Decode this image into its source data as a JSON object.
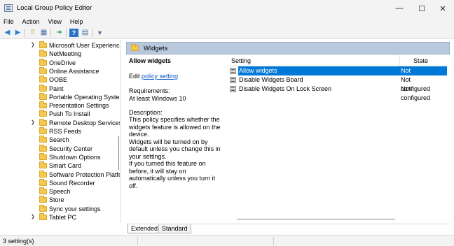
{
  "window": {
    "title": "Local Group Policy Editor",
    "minimize_glyph": "—",
    "maximize_glyph": "☐",
    "close_glyph": "✕"
  },
  "menu": [
    "File",
    "Action",
    "View",
    "Help"
  ],
  "toolbar": {
    "icons": [
      "back-arrow-icon",
      "forward-arrow-icon",
      "up-folder-icon",
      "show-hide-tree-icon",
      "export-list-icon",
      "help-icon",
      "properties-icon",
      "filter-icon"
    ],
    "glyphs": [
      "◀",
      "▶",
      "⇧",
      "▦",
      "➜",
      "?",
      "▤",
      "▼"
    ]
  },
  "tree": {
    "items": [
      {
        "label": "Microsoft User Experience",
        "expandable": true
      },
      {
        "label": "NetMeeting",
        "expandable": false
      },
      {
        "label": "OneDrive",
        "expandable": false
      },
      {
        "label": "Online Assistance",
        "expandable": false
      },
      {
        "label": "OOBE",
        "expandable": false
      },
      {
        "label": "Paint",
        "expandable": false
      },
      {
        "label": "Portable Operating System",
        "expandable": false
      },
      {
        "label": "Presentation Settings",
        "expandable": false
      },
      {
        "label": "Push To Install",
        "expandable": false
      },
      {
        "label": "Remote Desktop Services",
        "expandable": true
      },
      {
        "label": "RSS Feeds",
        "expandable": false
      },
      {
        "label": "Search",
        "expandable": false
      },
      {
        "label": "Security Center",
        "expandable": false
      },
      {
        "label": "Shutdown Options",
        "expandable": false
      },
      {
        "label": "Smart Card",
        "expandable": false
      },
      {
        "label": "Software Protection Platfo",
        "expandable": false
      },
      {
        "label": "Sound Recorder",
        "expandable": false
      },
      {
        "label": "Speech",
        "expandable": false
      },
      {
        "label": "Store",
        "expandable": false
      },
      {
        "label": "Sync your settings",
        "expandable": false
      },
      {
        "label": "Tablet PC",
        "expandable": true
      }
    ]
  },
  "right": {
    "header": "Widgets",
    "description": {
      "title": "Allow widgets",
      "edit_prefix": "Edit ",
      "edit_link": "policy setting",
      "requirements_label": "Requirements:",
      "requirements_value": "At least Windows 10",
      "description_label": "Description:",
      "paragraphs": [
        "This policy specifies whether the widgets feature is allowed on the device.",
        "Widgets will be turned on by default unless you change this in your settings.",
        "If you turned this feature on before, it will stay on automatically unless you turn it off."
      ]
    },
    "columns": {
      "setting": "Setting",
      "state": "State"
    },
    "settings": [
      {
        "name": "Allow widgets",
        "state": "Not configured",
        "selected": true
      },
      {
        "name": "Disable Widgets Board",
        "state": "Not configured",
        "selected": false
      },
      {
        "name": "Disable Widgets On Lock Screen",
        "state": "Not configured",
        "selected": false
      }
    ]
  },
  "tabs": [
    "Extended",
    "Standard"
  ],
  "status": {
    "text": "3 setting(s)"
  },
  "colors": {
    "selection": "#0078d7",
    "header_band": "#b8c9de",
    "link": "#0a58c9",
    "folder": "#f4c94e"
  }
}
